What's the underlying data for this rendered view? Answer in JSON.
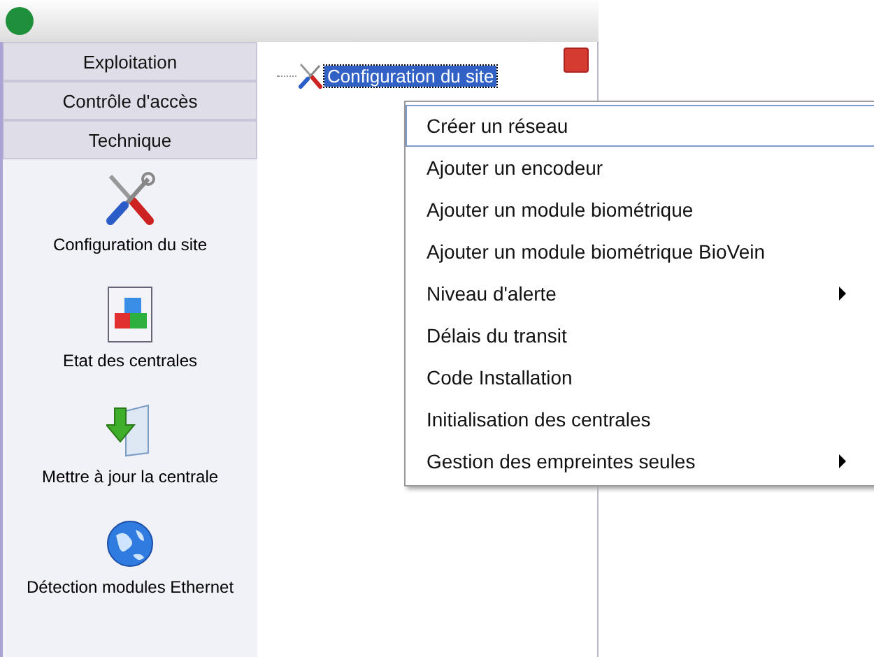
{
  "sidebar": {
    "tabs": [
      {
        "label": "Exploitation"
      },
      {
        "label": "Contrôle d'accès"
      },
      {
        "label": "Technique"
      }
    ],
    "items": [
      {
        "kind": "tools",
        "label": "Configuration du site"
      },
      {
        "kind": "blocks",
        "label": "Etat des centrales"
      },
      {
        "kind": "update",
        "label": "Mettre à jour la centrale"
      },
      {
        "kind": "globe",
        "label": "Détection modules Ethernet"
      }
    ]
  },
  "tree": {
    "nodes": [
      {
        "label": "Configuration du site",
        "selected": true
      }
    ]
  },
  "context_menu": {
    "items": [
      {
        "label": "Créer un réseau",
        "selected": true,
        "submenu": false
      },
      {
        "label": "Ajouter un encodeur",
        "selected": false,
        "submenu": false
      },
      {
        "label": "Ajouter un module biométrique",
        "selected": false,
        "submenu": false
      },
      {
        "label": "Ajouter un module biométrique BioVein",
        "selected": false,
        "submenu": false
      },
      {
        "label": "Niveau d'alerte",
        "selected": false,
        "submenu": true
      },
      {
        "label": "Délais du transit",
        "selected": false,
        "submenu": false
      },
      {
        "label": "Code Installation",
        "selected": false,
        "submenu": false
      },
      {
        "label": "Initialisation des centrales",
        "selected": false,
        "submenu": false
      },
      {
        "label": "Gestion des empreintes seules",
        "selected": false,
        "submenu": true
      }
    ]
  }
}
